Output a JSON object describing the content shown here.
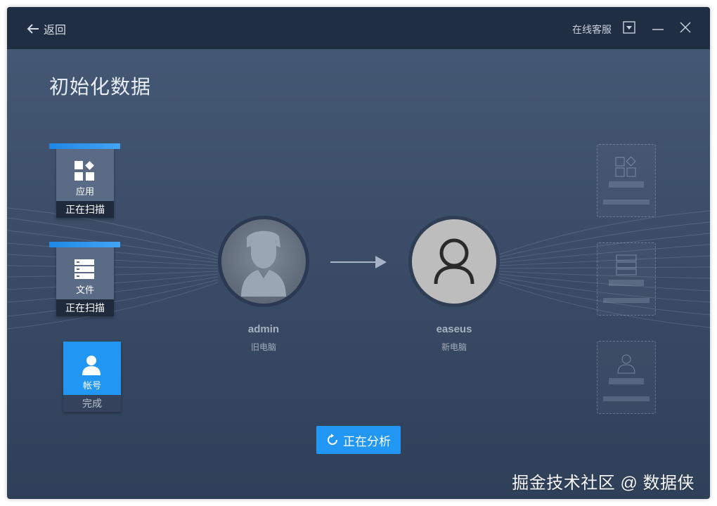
{
  "header": {
    "back_label": "返回",
    "service_label": "在线客服"
  },
  "page": {
    "title": "初始化数据"
  },
  "categories": [
    {
      "name": "应用",
      "status": "正在扫描",
      "icon": "apps-icon"
    },
    {
      "name": "文件",
      "status": "正在扫描",
      "icon": "files-icon"
    },
    {
      "name": "帐号",
      "status": "完成",
      "icon": "account-icon"
    }
  ],
  "transfer": {
    "source": {
      "name": "admin",
      "subtitle": "旧电脑"
    },
    "target": {
      "name": "easeus",
      "subtitle": "新电脑"
    }
  },
  "action": {
    "label": "正在分析"
  },
  "watermark": "掘金技术社区 @ 数据侠",
  "colors": {
    "accent": "#2196f3",
    "titlebar": "#202e43",
    "window_bg": "#3b4d68"
  }
}
